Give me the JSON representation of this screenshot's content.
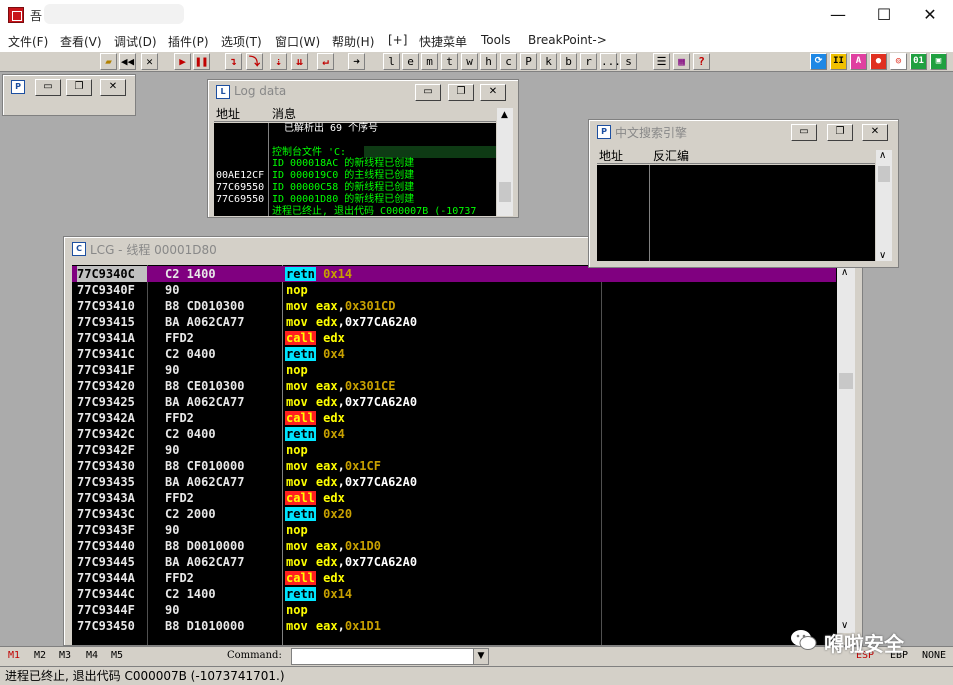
{
  "app": {
    "title": "吾",
    "window_controls": {
      "minimize": "—",
      "maximize": "☐",
      "close": "✕"
    }
  },
  "menu": [
    "文件(F)",
    "查看(V)",
    "调试(D)",
    "插件(P)",
    "选项(T)",
    "窗口(W)",
    "帮助(H)",
    "[+]",
    "快捷菜单",
    "Tools",
    "BreakPoint->"
  ],
  "toolbar": {
    "letters": [
      "l",
      "e",
      "m",
      "t",
      "w",
      "h",
      "c",
      "P",
      "k",
      "b",
      "r",
      "...",
      "s"
    ]
  },
  "log_window": {
    "title": "Log data",
    "headers": {
      "address": "地址",
      "message": "消息"
    },
    "lines": [
      {
        "addr": "",
        "msg": "已解析出 69 个序号",
        "color": "#ffffff"
      },
      {
        "addr": "",
        "msg": "",
        "color": "#00ff00"
      },
      {
        "addr": "",
        "msg": "控制台文件 'C:",
        "color": "#00ff00"
      },
      {
        "addr": "",
        "msg": "ID 000018AC 的新线程已创建",
        "color": "#00ff00"
      },
      {
        "addr": "00AE12CF",
        "msg": "ID 000019C0 的主线程已创建",
        "color": "#00ff00"
      },
      {
        "addr": "77C69550",
        "msg": "ID 00000C58 的新线程已创建",
        "color": "#00ff00"
      },
      {
        "addr": "77C69550",
        "msg": "ID 00001D80 的新线程已创建",
        "color": "#00ff00"
      },
      {
        "addr": "",
        "msg": "进程已终止, 退出代码 C000007B (-10737",
        "color": "#00ff00"
      }
    ]
  },
  "search_window": {
    "title": "中文搜索引擎",
    "headers": {
      "address": "地址",
      "disasm": "反汇编"
    }
  },
  "cpu_window": {
    "title": "LCG - 线程 00001D80",
    "rows": [
      {
        "addr": "77C9340C",
        "hex": "C2 1400",
        "mn": "retn",
        "ops": [
          {
            "t": "0x14",
            "k": "num"
          }
        ]
      },
      {
        "addr": "77C9340F",
        "hex": "90",
        "mn": "nop",
        "ops": []
      },
      {
        "addr": "77C93410",
        "hex": "B8 CD010300",
        "mn": "mov",
        "ops": [
          {
            "t": "eax",
            "k": "reg"
          },
          {
            "t": ",",
            "k": "plain"
          },
          {
            "t": "0x301CD",
            "k": "num"
          }
        ]
      },
      {
        "addr": "77C93415",
        "hex": "BA A062CA77",
        "mn": "mov",
        "ops": [
          {
            "t": "edx",
            "k": "reg"
          },
          {
            "t": ",0x77CA62A0",
            "k": "plain"
          }
        ]
      },
      {
        "addr": "77C9341A",
        "hex": "FFD2",
        "mn": "call",
        "ops": [
          {
            "t": "edx",
            "k": "reg"
          }
        ]
      },
      {
        "addr": "77C9341C",
        "hex": "C2 0400",
        "mn": "retn",
        "ops": [
          {
            "t": "0x4",
            "k": "num"
          }
        ]
      },
      {
        "addr": "77C9341F",
        "hex": "90",
        "mn": "nop",
        "ops": []
      },
      {
        "addr": "77C93420",
        "hex": "B8 CE010300",
        "mn": "mov",
        "ops": [
          {
            "t": "eax",
            "k": "reg"
          },
          {
            "t": ",",
            "k": "plain"
          },
          {
            "t": "0x301CE",
            "k": "num"
          }
        ]
      },
      {
        "addr": "77C93425",
        "hex": "BA A062CA77",
        "mn": "mov",
        "ops": [
          {
            "t": "edx",
            "k": "reg"
          },
          {
            "t": ",0x77CA62A0",
            "k": "plain"
          }
        ]
      },
      {
        "addr": "77C9342A",
        "hex": "FFD2",
        "mn": "call",
        "ops": [
          {
            "t": "edx",
            "k": "reg"
          }
        ]
      },
      {
        "addr": "77C9342C",
        "hex": "C2 0400",
        "mn": "retn",
        "ops": [
          {
            "t": "0x4",
            "k": "num"
          }
        ]
      },
      {
        "addr": "77C9342F",
        "hex": "90",
        "mn": "nop",
        "ops": []
      },
      {
        "addr": "77C93430",
        "hex": "B8 CF010000",
        "mn": "mov",
        "ops": [
          {
            "t": "eax",
            "k": "reg"
          },
          {
            "t": ",",
            "k": "plain"
          },
          {
            "t": "0x1CF",
            "k": "num"
          }
        ]
      },
      {
        "addr": "77C93435",
        "hex": "BA A062CA77",
        "mn": "mov",
        "ops": [
          {
            "t": "edx",
            "k": "reg"
          },
          {
            "t": ",0x77CA62A0",
            "k": "plain"
          }
        ]
      },
      {
        "addr": "77C9343A",
        "hex": "FFD2",
        "mn": "call",
        "ops": [
          {
            "t": "edx",
            "k": "reg"
          }
        ]
      },
      {
        "addr": "77C9343C",
        "hex": "C2 2000",
        "mn": "retn",
        "ops": [
          {
            "t": "0x20",
            "k": "num"
          }
        ]
      },
      {
        "addr": "77C9343F",
        "hex": "90",
        "mn": "nop",
        "ops": []
      },
      {
        "addr": "77C93440",
        "hex": "B8 D0010000",
        "mn": "mov",
        "ops": [
          {
            "t": "eax",
            "k": "reg"
          },
          {
            "t": ",",
            "k": "plain"
          },
          {
            "t": "0x1D0",
            "k": "num"
          }
        ]
      },
      {
        "addr": "77C93445",
        "hex": "BA A062CA77",
        "mn": "mov",
        "ops": [
          {
            "t": "edx",
            "k": "reg"
          },
          {
            "t": ",0x77CA62A0",
            "k": "plain"
          }
        ]
      },
      {
        "addr": "77C9344A",
        "hex": "FFD2",
        "mn": "call",
        "ops": [
          {
            "t": "edx",
            "k": "reg"
          }
        ]
      },
      {
        "addr": "77C9344C",
        "hex": "C2 1400",
        "mn": "retn",
        "ops": [
          {
            "t": "0x14",
            "k": "num"
          }
        ]
      },
      {
        "addr": "77C9344F",
        "hex": "90",
        "mn": "nop",
        "ops": []
      },
      {
        "addr": "77C93450",
        "hex": "B8 D1010000",
        "mn": "mov",
        "ops": [
          {
            "t": "eax",
            "k": "reg"
          },
          {
            "t": ",",
            "k": "plain"
          },
          {
            "t": "0x1D1",
            "k": "num"
          }
        ]
      }
    ]
  },
  "command_bar": {
    "tabs": [
      "M1",
      "M2",
      "M3",
      "M4",
      "M5"
    ],
    "label": "Command:",
    "value": "",
    "right": [
      "ESP",
      "EBP",
      "NONE"
    ]
  },
  "watermark": "嘚啦安全",
  "status": "进程已终止, 退出代码 C000007B (-1073741701.)"
}
